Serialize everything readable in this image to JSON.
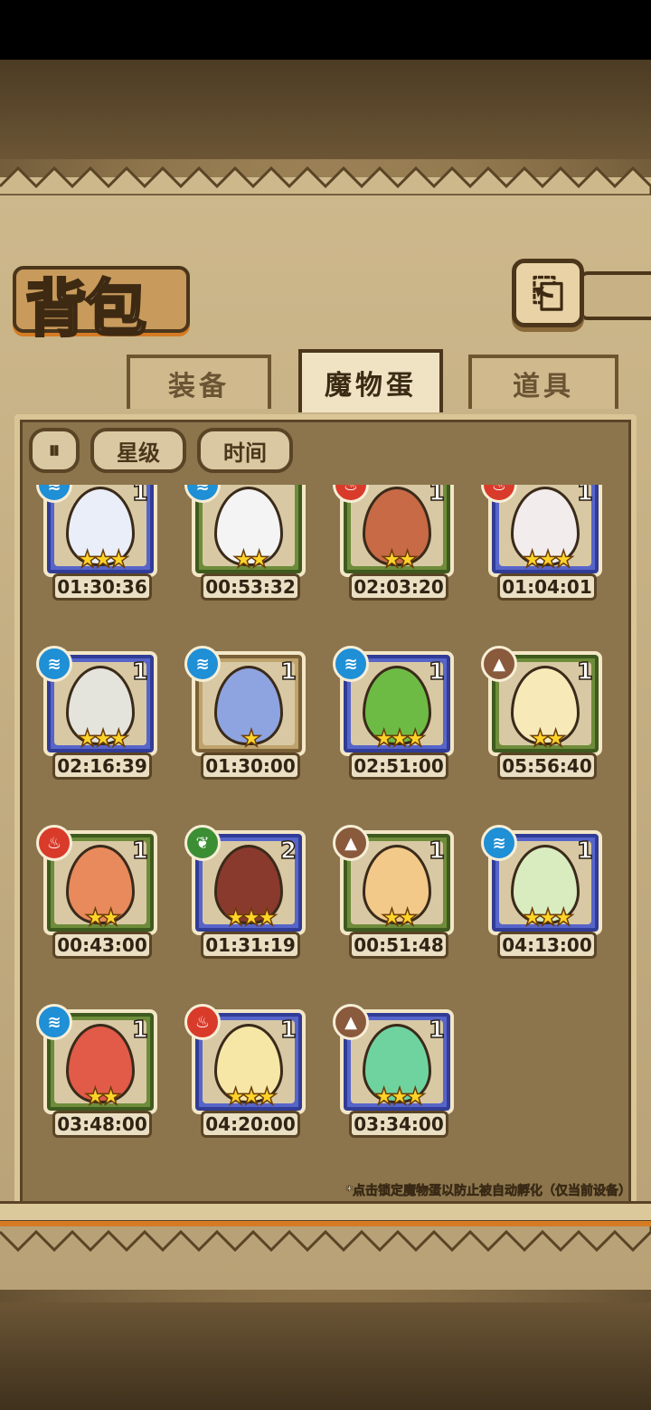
{
  "header": {
    "title": "背包",
    "back_icon": "back-arrow-icon"
  },
  "tabs": [
    {
      "label": "装备",
      "active": false
    },
    {
      "label": "魔物蛋",
      "active": true
    },
    {
      "label": "道具",
      "active": false
    }
  ],
  "filters": {
    "toggle_icon": "pause-icon",
    "star_label": "星级",
    "time_label": "时间"
  },
  "eggs": [
    {
      "element": "water",
      "count": "1",
      "stars": 3,
      "time": "01:30:36",
      "frame": "blue",
      "egg_color": "#e9eef8"
    },
    {
      "element": "water",
      "count": "",
      "stars": 2,
      "time": "00:53:32",
      "frame": "green",
      "egg_color": "#f4f4f4"
    },
    {
      "element": "fire",
      "count": "1",
      "stars": 2,
      "time": "02:03:20",
      "frame": "green",
      "egg_color": "#c76a45"
    },
    {
      "element": "fire",
      "count": "1",
      "stars": 3,
      "time": "01:04:01",
      "frame": "blue",
      "egg_color": "#f2ecec"
    },
    {
      "element": "water",
      "count": "1",
      "stars": 3,
      "time": "02:16:39",
      "frame": "blue",
      "egg_color": "#e4e4dc"
    },
    {
      "element": "water",
      "count": "1",
      "stars": 1,
      "time": "01:30:00",
      "frame": "tan",
      "egg_color": "#8ea4e0"
    },
    {
      "element": "water",
      "count": "1",
      "stars": 3,
      "time": "02:51:00",
      "frame": "blue",
      "egg_color": "#6dbb45"
    },
    {
      "element": "earth",
      "count": "1",
      "stars": 2,
      "time": "05:56:40",
      "frame": "green",
      "egg_color": "#f7eab8"
    },
    {
      "element": "fire",
      "count": "1",
      "stars": 2,
      "time": "00:43:00",
      "frame": "green",
      "egg_color": "#e88a5c"
    },
    {
      "element": "grass",
      "count": "2",
      "stars": 3,
      "time": "01:31:19",
      "frame": "blue",
      "egg_color": "#8a3a2c"
    },
    {
      "element": "earth",
      "count": "1",
      "stars": 2,
      "time": "00:51:48",
      "frame": "green",
      "egg_color": "#f3c98a"
    },
    {
      "element": "water",
      "count": "1",
      "stars": 3,
      "time": "04:13:00",
      "frame": "blue",
      "egg_color": "#d9ecc0"
    },
    {
      "element": "water",
      "count": "1",
      "stars": 2,
      "time": "03:48:00",
      "frame": "green",
      "egg_color": "#e25a48"
    },
    {
      "element": "fire",
      "count": "1",
      "stars": 3,
      "time": "04:20:00",
      "frame": "blue",
      "egg_color": "#f6e7a6"
    },
    {
      "element": "earth",
      "count": "1",
      "stars": 3,
      "time": "03:34:00",
      "frame": "blue",
      "egg_color": "#6fd3a0"
    }
  ],
  "hint": "*点击锁定魔物蛋以防止被自动孵化（仅当前设备）"
}
